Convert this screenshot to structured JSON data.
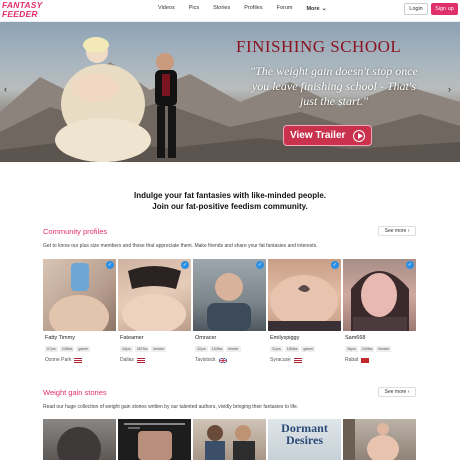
{
  "brand": {
    "logo_line1": "FANTASY",
    "logo_line2": "FEEDER",
    "accent": "#e0306a"
  },
  "nav": {
    "items": [
      "Videos",
      "Pics",
      "Stories",
      "Profiles",
      "Forum"
    ],
    "more_label": "More"
  },
  "auth": {
    "login_label": "Login",
    "signup_label": "Sign up"
  },
  "hero": {
    "title": "FINISHING SCHOOL",
    "quote": "\"The weight gain doesn't stop once you leave finishing school - That's just the start.\"",
    "trailer_label": "View Trailer"
  },
  "intro": {
    "line1": "Indulge your fat fantasies with like-minded people.",
    "line2": "Join our fat-positive feedism community."
  },
  "community": {
    "title": "Community profiles",
    "see_more": "See more",
    "description": "Get to know our plus size members and those that appreciate them. Make friends and share your fat fantasies and interests.",
    "profiles": [
      {
        "name": "Fatty Timmy",
        "tags": [
          "67yrs",
          "248lbs",
          "gainer"
        ],
        "location": "Ozone Park",
        "flag": "us"
      },
      {
        "name": "Fateamer",
        "tags": [
          "44yrs",
          "287lbs",
          "feedee"
        ],
        "location": "Dallas",
        "flag": "us"
      },
      {
        "name": "Omracer",
        "tags": [
          "32yrs",
          "154lbs",
          "feeder"
        ],
        "location": "Tavistock",
        "flag": "uk"
      },
      {
        "name": "Emilyspiggy",
        "tags": [
          "31yrs",
          "180lbs",
          "gainer"
        ],
        "location": "Syracuse",
        "flag": "us"
      },
      {
        "name": "Sam668",
        "tags": [
          "36yrs",
          "240lbs",
          "feedee"
        ],
        "location": "Rabat",
        "flag": "ma"
      }
    ]
  },
  "stories": {
    "title": "Weight gain stories",
    "see_more": "See more",
    "description": "Read our huge collection of weight gain stories written by our talented authors, vividly bringing their fantasies to life.",
    "cover_title_line1": "Dormant",
    "cover_title_line2": "Desires"
  }
}
